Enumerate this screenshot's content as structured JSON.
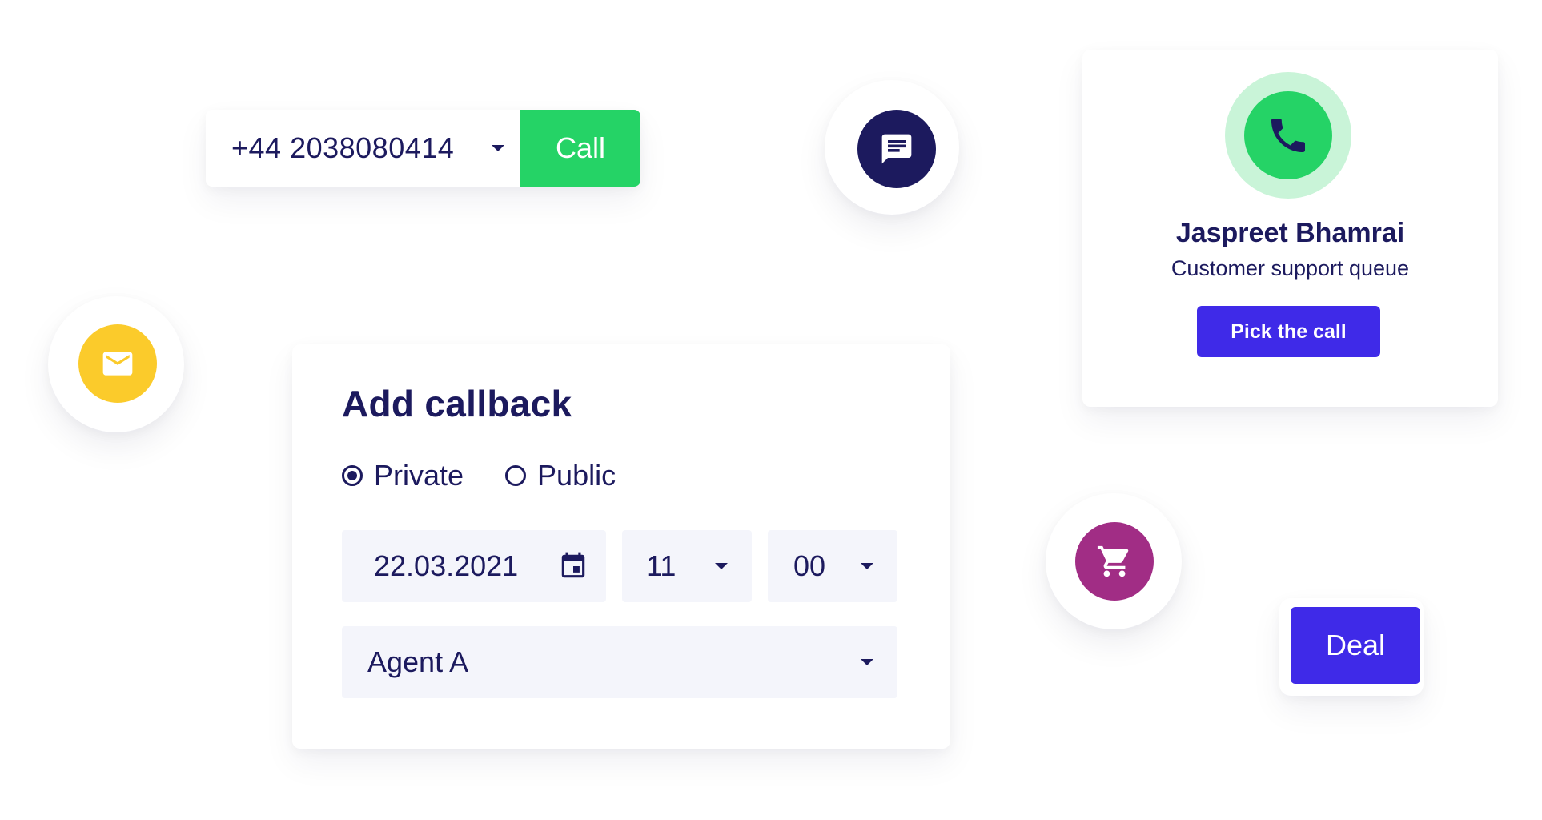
{
  "phone_bar": {
    "number": "+44 2038080414",
    "call_label": "Call"
  },
  "callback": {
    "title": "Add callback",
    "visibility_options": [
      "Private",
      "Public"
    ],
    "selected_visibility": "Private",
    "date": "22.03.2021",
    "hour": "11",
    "minute": "00",
    "agent": "Agent A"
  },
  "contact": {
    "name": "Jaspreet Bhamrai",
    "queue": "Customer support queue",
    "pick_label": "Pick the call"
  },
  "deal": {
    "label": "Deal"
  },
  "icons": {
    "chat": "chat-icon",
    "mail": "mail-icon",
    "cart": "cart-icon",
    "phone": "phone-icon",
    "calendar": "calendar-icon",
    "caret": "caret-down-icon"
  },
  "colors": {
    "navy": "#1c1a5e",
    "green": "#25d366",
    "green_halo": "#c9f4d8",
    "purple": "#3f2ae8",
    "yellow": "#fbcb2b",
    "magenta": "#a12d85",
    "field_bg": "#f4f5fb"
  }
}
